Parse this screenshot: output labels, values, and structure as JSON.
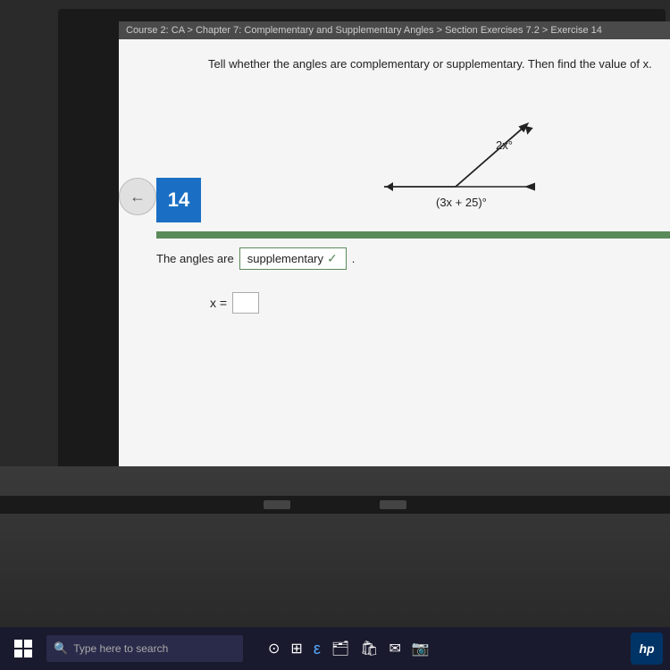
{
  "breadcrumb": {
    "text": "Course 2: CA > Chapter 7: Complementary and Supplementary Angles > Section Exercises 7.2 > Exercise 14"
  },
  "problem": {
    "question": "Tell whether the angles are complementary or supplementary. Then find the value of x.",
    "question_number": "14",
    "angle1_label": "2x°",
    "angle2_label": "(3x + 25)°"
  },
  "answer": {
    "prefix": "The angles are",
    "dropdown_value": "supplementary",
    "check_symbol": "✓",
    "x_label": "x =",
    "x_value": ""
  },
  "taskbar": {
    "search_placeholder": "Type here to search",
    "hp_label": "hp"
  }
}
